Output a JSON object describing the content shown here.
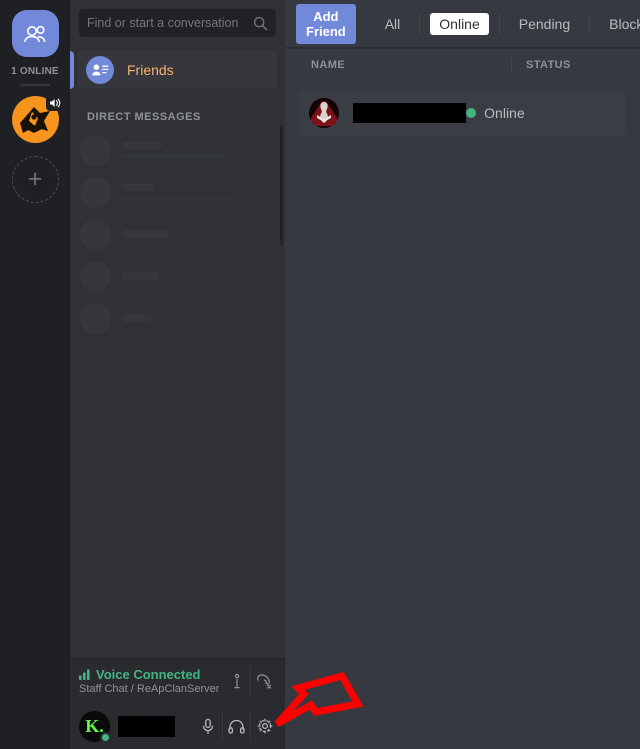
{
  "rail": {
    "home_button": {
      "icon": "friends-home-icon",
      "label": ""
    },
    "online_count": "1 ONLINE",
    "server": {
      "icon": "reap-clan-server-icon",
      "badge_icon": "speaker-icon"
    },
    "add_server": {
      "label": "+"
    }
  },
  "sidebar": {
    "search": {
      "placeholder": "Find or start a conversation",
      "value": "",
      "icon": "search-icon"
    },
    "friends_item": {
      "label": "Friends",
      "icon": "friends-list-icon"
    },
    "dm_header": "DIRECT MESSAGES",
    "dm_placeholders": [
      {
        "title_width": 40,
        "sub_width": 105
      },
      {
        "title_width": 33,
        "sub_width": 113
      },
      {
        "title_width": 48,
        "sub_width": 0
      },
      {
        "title_width": 37,
        "sub_width": 0
      },
      {
        "title_width": 30,
        "sub_width": 0
      }
    ]
  },
  "voice_panel": {
    "status": "Voice Connected",
    "channel": "Staff Chat / ReApClanServer",
    "status_color": "#43b581",
    "buttons": [
      {
        "name": "ping-icon",
        "label": ""
      },
      {
        "name": "disconnect-call-icon",
        "label": ""
      }
    ]
  },
  "user_panel": {
    "avatar_letter": "K.",
    "avatar_color": "#5dfc3c",
    "username": "",
    "status_color": "#43b581",
    "buttons": [
      {
        "name": "microphone-icon",
        "label": ""
      },
      {
        "name": "headphones-icon",
        "label": ""
      },
      {
        "name": "settings-gear-icon",
        "label": ""
      }
    ]
  },
  "main": {
    "add_friend_label": "Add Friend",
    "add_friend_color": "#7289da",
    "tabs": [
      {
        "label": "All",
        "active": false
      },
      {
        "label": "Online",
        "active": true
      },
      {
        "label": "Pending",
        "active": false
      },
      {
        "label": "Blocked",
        "active": false
      }
    ],
    "columns": {
      "name": "NAME",
      "status": "STATUS"
    },
    "friends": [
      {
        "name": "",
        "status": "Online",
        "status_color": "#43b581",
        "avatar": "red-dark-avatar"
      }
    ]
  },
  "annotation": {
    "arrow": {
      "color": "#fe0000",
      "direction": "left",
      "points_to": "settings-gear-icon"
    }
  }
}
